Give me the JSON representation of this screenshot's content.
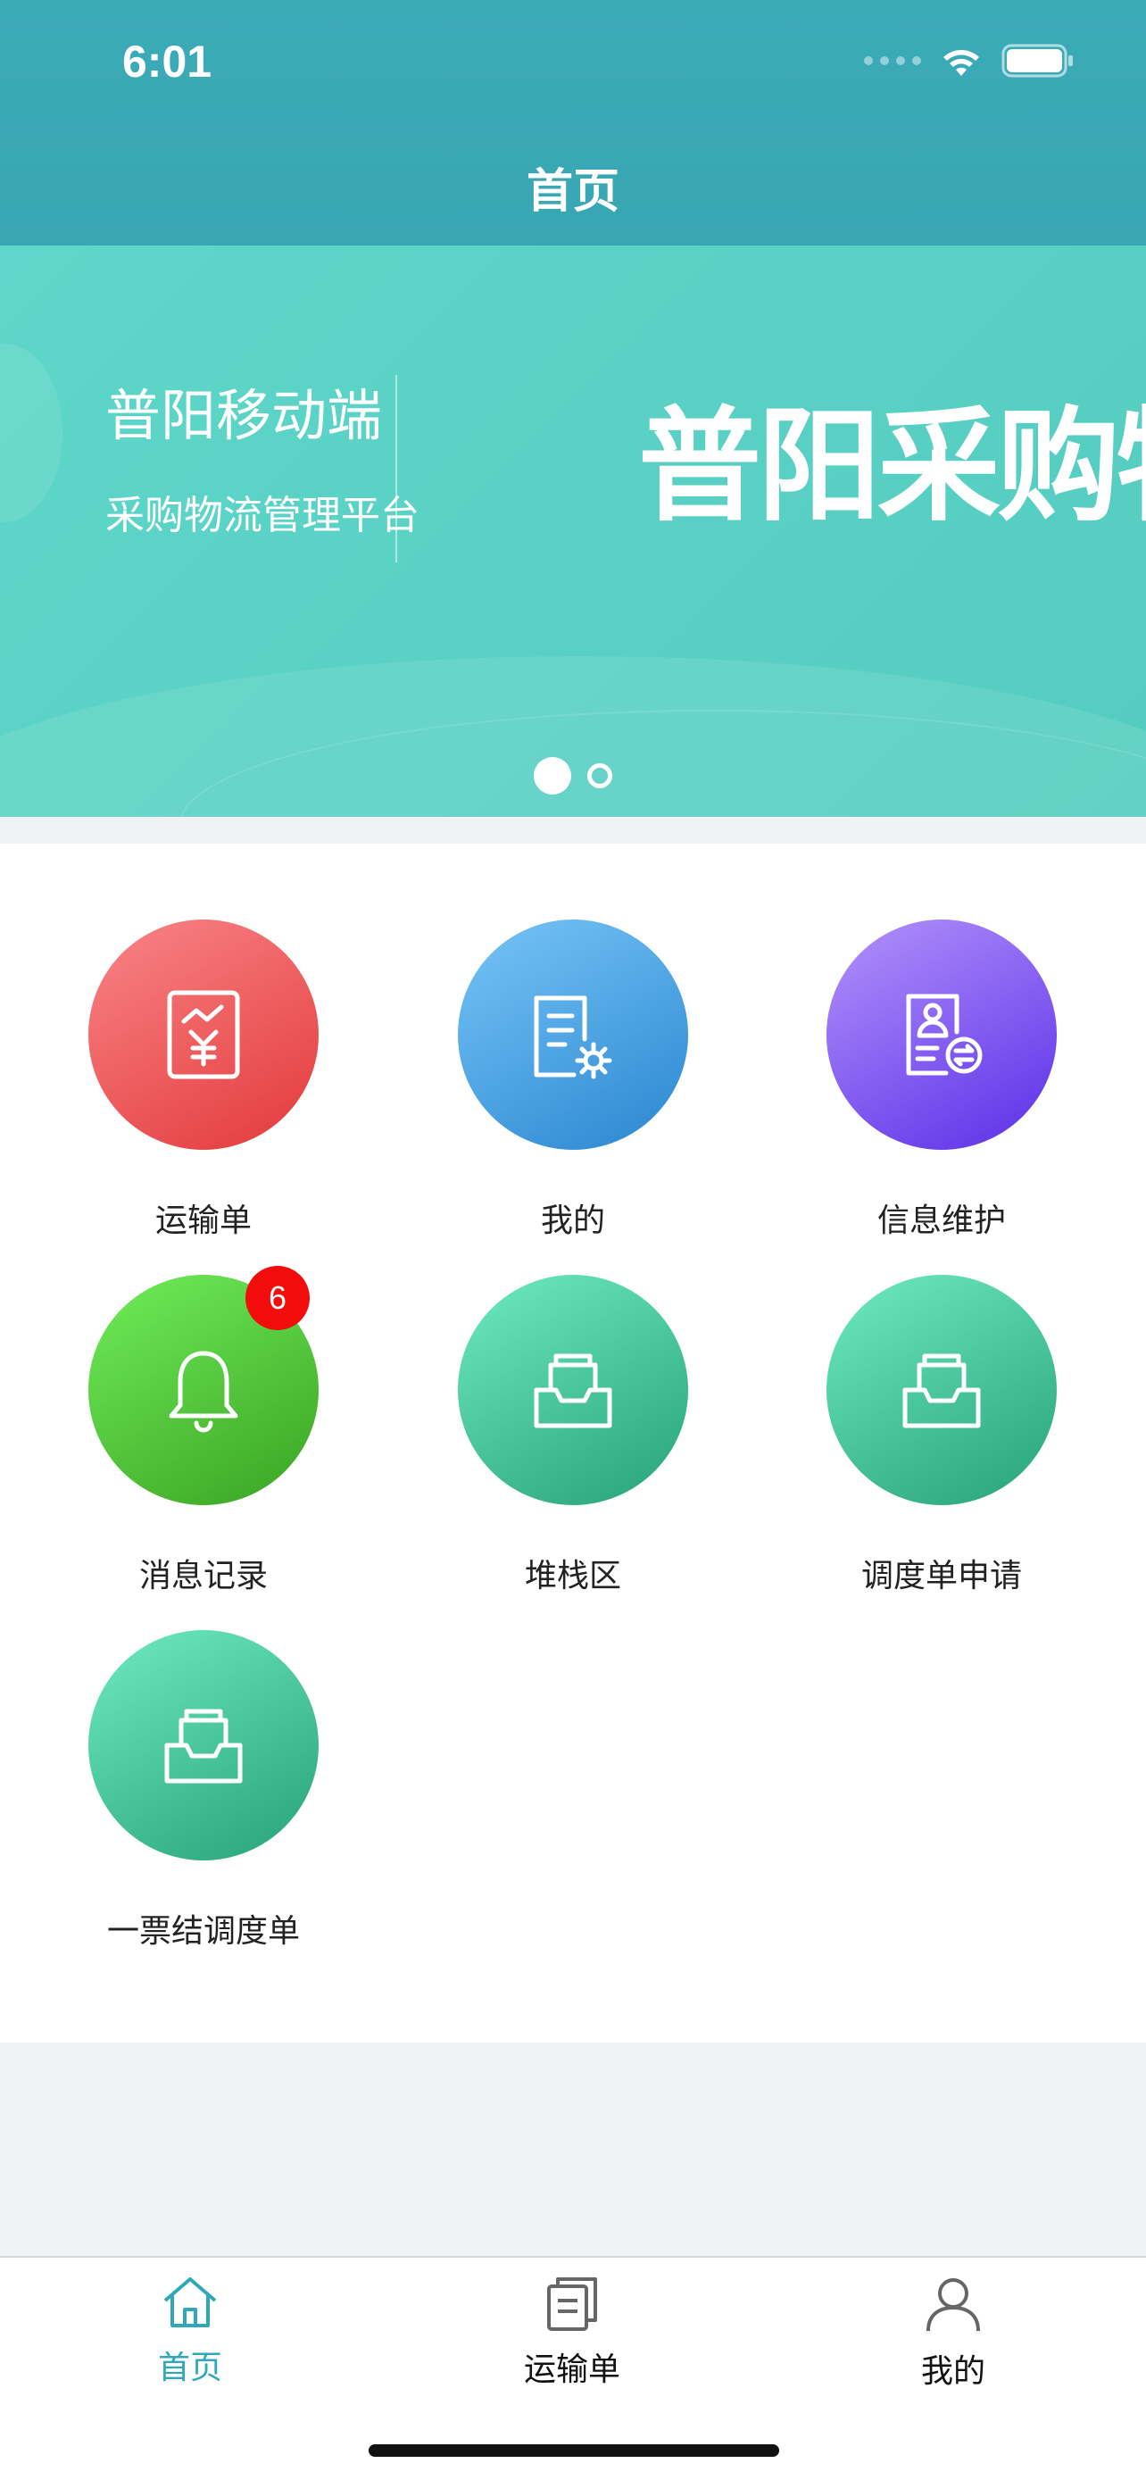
{
  "status_bar": {
    "time": "6:01"
  },
  "header": {
    "title": "首页"
  },
  "banner": {
    "subtitle_1": "普阳移动端",
    "subtitle_2": "采购物流管理平台",
    "brand_text": "普阳采购物流",
    "pages": 2,
    "active_page": 1
  },
  "grid": {
    "items": [
      {
        "label": "运输单",
        "icon": "invoice-yen-icon",
        "color": "red"
      },
      {
        "label": "我的",
        "icon": "document-settings-icon",
        "color": "blue"
      },
      {
        "label": "信息维护",
        "icon": "profile-card-icon",
        "color": "purple"
      },
      {
        "label": "消息记录",
        "icon": "bell-icon",
        "color": "green",
        "badge": "6"
      },
      {
        "label": "堆栈区",
        "icon": "inbox-tray-icon",
        "color": "teal"
      },
      {
        "label": "调度单申请",
        "icon": "inbox-tray-icon",
        "color": "teal"
      },
      {
        "label": "一票结调度单",
        "icon": "inbox-tray-icon",
        "color": "teal"
      }
    ]
  },
  "tabbar": {
    "tabs": [
      {
        "label": "首页",
        "icon": "home-icon",
        "active": true
      },
      {
        "label": "运输单",
        "icon": "documents-icon",
        "active": false
      },
      {
        "label": "我的",
        "icon": "user-icon",
        "active": false
      }
    ]
  },
  "colors": {
    "header_bg": "#3cabb8",
    "banner_bg": "#5ed6c9",
    "active_tab": "#2fa8b7",
    "badge": "#f20c0c"
  }
}
